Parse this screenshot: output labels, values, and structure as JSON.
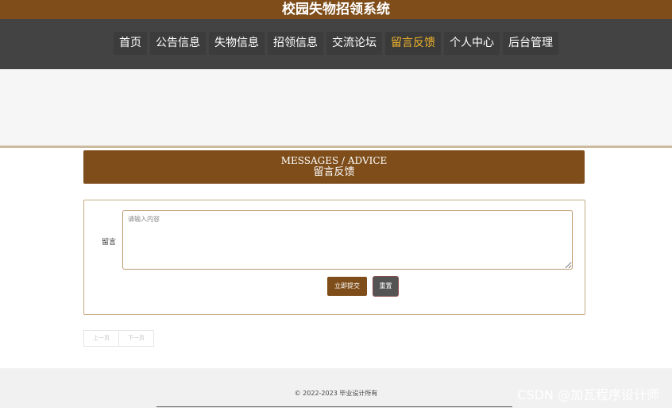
{
  "site": {
    "title": "校园失物招领系统"
  },
  "nav": {
    "items": [
      "首页",
      "公告信息",
      "失物信息",
      "招领信息",
      "交流论坛",
      "留言反馈",
      "个人中心",
      "后台管理"
    ],
    "active": "留言反馈"
  },
  "section": {
    "title_en": "MESSAGES / ADVICE",
    "title_cn": "留言反馈"
  },
  "form": {
    "label": "留言",
    "placeholder": "请输入内容",
    "value": "",
    "submit_label": "立即提交",
    "reset_label": "重置"
  },
  "pager": {
    "prev": "上一页",
    "next": "下一页"
  },
  "footer": {
    "copyright": "© 2022-2023 毕业设计所有"
  },
  "watermark": "CSDN @加瓦程序设计师",
  "colors": {
    "brand": "#7e4d19",
    "nav_bg": "#434343",
    "nav_active": "#f0b32a"
  }
}
